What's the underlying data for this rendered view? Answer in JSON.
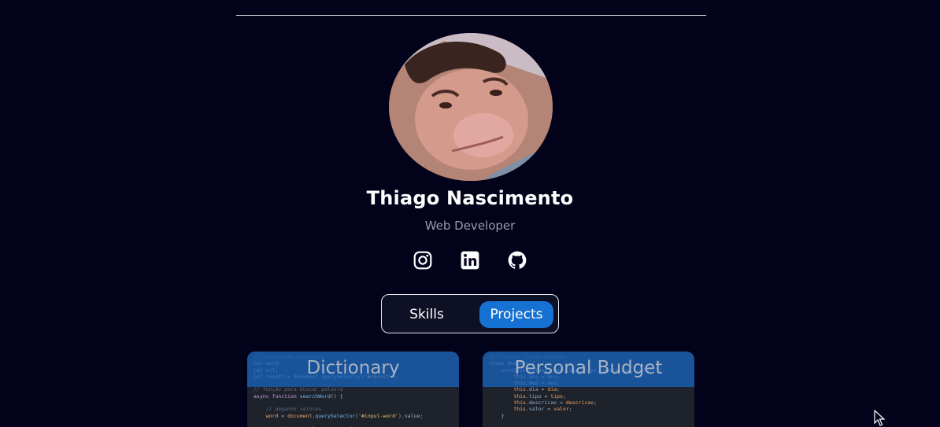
{
  "profile": {
    "name": "Thiago Nascimento",
    "role": "Web Developer",
    "avatar": "profile-photo"
  },
  "socials": [
    {
      "name": "Instagram",
      "icon": "instagram-icon"
    },
    {
      "name": "LinkedIn",
      "icon": "linkedin-icon"
    },
    {
      "name": "GitHub",
      "icon": "github-icon"
    }
  ],
  "tabs": {
    "skills": "Skills",
    "projects": "Projects",
    "active": "projects"
  },
  "projects": [
    {
      "title": "Dictionary"
    },
    {
      "title": "Personal Budget"
    }
  ],
  "colors": {
    "background": "#02021a",
    "accent": "#1572d2",
    "muted_text": "#9a9aae"
  }
}
